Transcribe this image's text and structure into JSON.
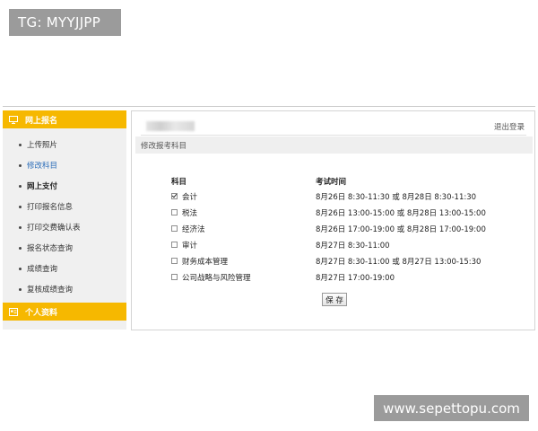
{
  "watermark_top": "TG: MYYJJPP",
  "watermark_bottom": "www.sepettopu.com",
  "sidebar": {
    "section1_title": "网上报名",
    "items": [
      {
        "label": "上传照片"
      },
      {
        "label": "修改科目"
      },
      {
        "label": "网上支付"
      },
      {
        "label": "打印报名信息"
      },
      {
        "label": "打印交费确认表"
      },
      {
        "label": "报名状态查询"
      },
      {
        "label": "成绩查询"
      },
      {
        "label": "复核成绩查询"
      }
    ],
    "section2_title": "个人资料"
  },
  "main": {
    "logout_label": "退出登录",
    "section_title": "修改报考科目",
    "columns": {
      "subject": "科目",
      "time": "考试时间"
    },
    "rows": [
      {
        "subject": "会计",
        "checked": true,
        "time": "8月26日   8:30-11:30 或 8月28日   8:30-11:30"
      },
      {
        "subject": "税法",
        "checked": false,
        "time": "8月26日  13:00-15:00 或 8月28日 13:00-15:00"
      },
      {
        "subject": "经济法",
        "checked": false,
        "time": "8月26日  17:00-19:00 或 8月28日 17:00-19:00"
      },
      {
        "subject": "审计",
        "checked": false,
        "time": "8月27日   8:30-11:00"
      },
      {
        "subject": "财务成本管理",
        "checked": false,
        "time": "8月27日   8:30-11:00 或 8月27日 13:00-15:30"
      },
      {
        "subject": "公司战略与风险管理",
        "checked": false,
        "time": "8月27日  17:00-19:00"
      }
    ],
    "save_label": "保 存"
  },
  "colors": {
    "accent": "#f6b800",
    "active_link": "#2a6cb8",
    "sidebar_bg": "#f0f0f0"
  }
}
